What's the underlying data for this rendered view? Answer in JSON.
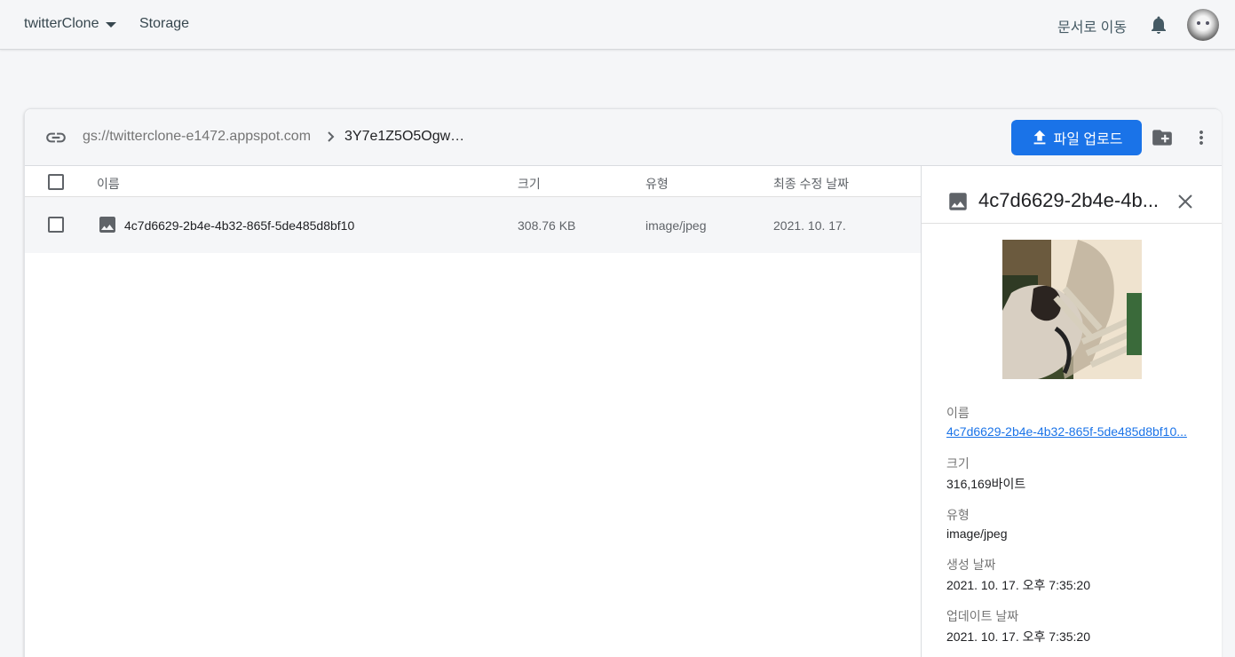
{
  "header": {
    "project": "twitterClone",
    "section": "Storage",
    "docs_link": "문서로 이동"
  },
  "pathbar": {
    "bucket": "gs://twitterclone-e1472.appspot.com",
    "folder": "3Y7e1Z5O5Ogw…",
    "upload_label": "파일 업로드"
  },
  "table": {
    "columns": [
      "이름",
      "크기",
      "유형",
      "최종 수정 날짜"
    ],
    "rows": [
      {
        "name": "4c7d6629-2b4e-4b32-865f-5de485d8bf10",
        "size": "308.76 KB",
        "type": "image/jpeg",
        "modified": "2021. 10. 17."
      }
    ]
  },
  "detail": {
    "title": "4c7d6629-2b4e-4b...",
    "name_label": "이름",
    "name_value": "4c7d6629-2b4e-4b32-865f-5de485d8bf10...",
    "size_label": "크기",
    "size_value": "316,169바이트",
    "type_label": "유형",
    "type_value": "image/jpeg",
    "created_label": "생성 날짜",
    "created_value": "2021. 10. 17. 오후 7:35:20",
    "updated_label": "업데이트 날짜",
    "updated_value": "2021. 10. 17. 오후 7:35:20"
  },
  "colors": {
    "accent": "#1a73e8",
    "header_bg": "#f5f6f8"
  },
  "icons": [
    "caret-down-icon",
    "bell-icon",
    "link-icon",
    "chevron-right-icon",
    "upload-icon",
    "create-folder-icon",
    "more-vert-icon",
    "image-icon",
    "close-icon"
  ]
}
